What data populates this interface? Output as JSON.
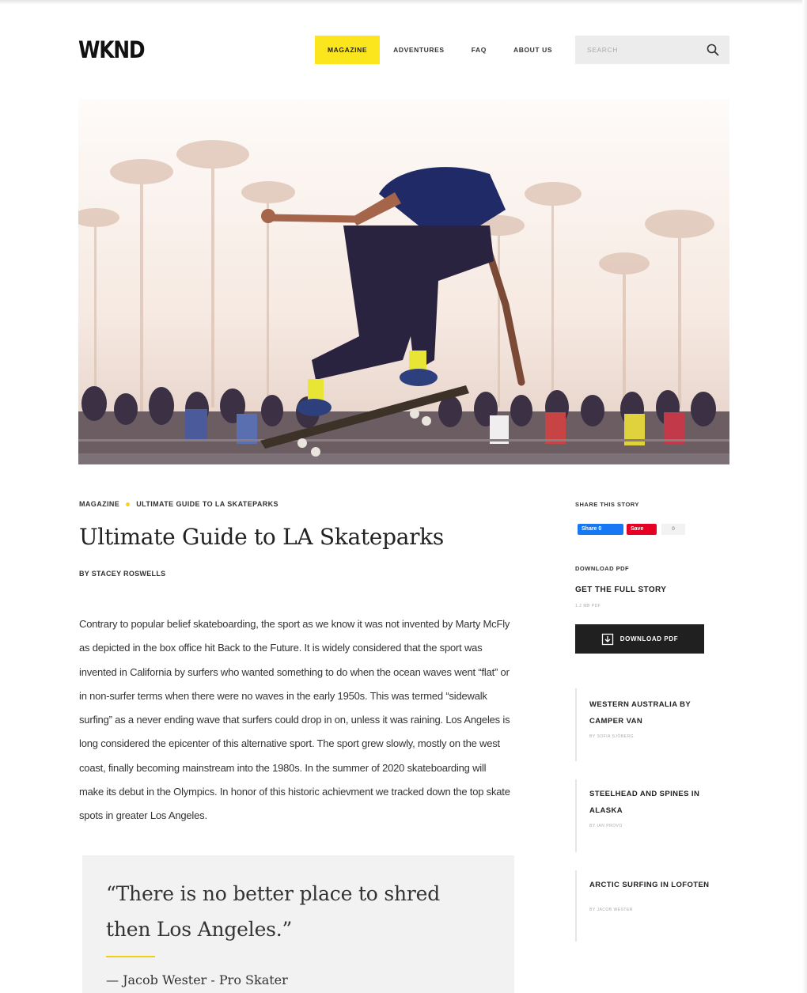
{
  "header": {
    "logo": "WKND",
    "nav": [
      {
        "label": "MAGAZINE",
        "active": true
      },
      {
        "label": "ADVENTURES",
        "active": false
      },
      {
        "label": "FAQ",
        "active": false
      },
      {
        "label": "ABOUT US",
        "active": false
      }
    ],
    "search_placeholder": "SEARCH"
  },
  "article": {
    "breadcrumb": [
      "MAGAZINE",
      "ULTIMATE GUIDE TO LA SKATEPARKS"
    ],
    "title": "Ultimate Guide to LA Skateparks",
    "byline": "BY STACEY ROSWELLS",
    "body": "Contrary to popular belief skateboarding, the sport as we know it was not invented by Marty McFly as depicted in the box office hit Back to the Future. It is widely considered that the sport was invented in California by surfers who wanted something to do when the ocean waves went “flat” or in non-surfer terms when there were no waves in the early 1950s. This was termed “sidewalk surfing” as a never ending wave that surfers could drop in on, unless it was raining. Los Angeles is long considered the epicenter of this alternative sport. The sport grew slowly, mostly on the west coast, finally becoming mainstream into the 1980s. In the summer of 2020 skateboarding will make its debut in the Olympics. In honor of this historic achievment we tracked down the top skate spots in greater Los Angeles.",
    "quote": "“There is no better place to shred then Los Angeles.”",
    "quote_author": "— Jacob Wester - Pro Skater"
  },
  "sidebar": {
    "share_label": "SHARE THIS STORY",
    "share_facebook": "Share 0",
    "share_pinterest": "Save",
    "share_count": "0",
    "download_label": "DOWNLOAD PDF",
    "download_title": "GET THE FULL STORY",
    "file_meta": "1.2 MB   PDF",
    "download_button": "DOWNLOAD PDF",
    "related": [
      {
        "title": "WESTERN AUSTRALIA BY CAMPER VAN",
        "author": "BY SOFIA SJÖBERG"
      },
      {
        "title": "STEELHEAD AND SPINES IN ALASKA",
        "author": "BY IAN PROVO"
      },
      {
        "title": "ARCTIC SURFING IN LOFOTEN",
        "author": "BY JACOB WESTER"
      }
    ]
  },
  "colors": {
    "accent": "#fbe51d",
    "dark": "#202020",
    "quote_bg": "#f2f2f2"
  }
}
